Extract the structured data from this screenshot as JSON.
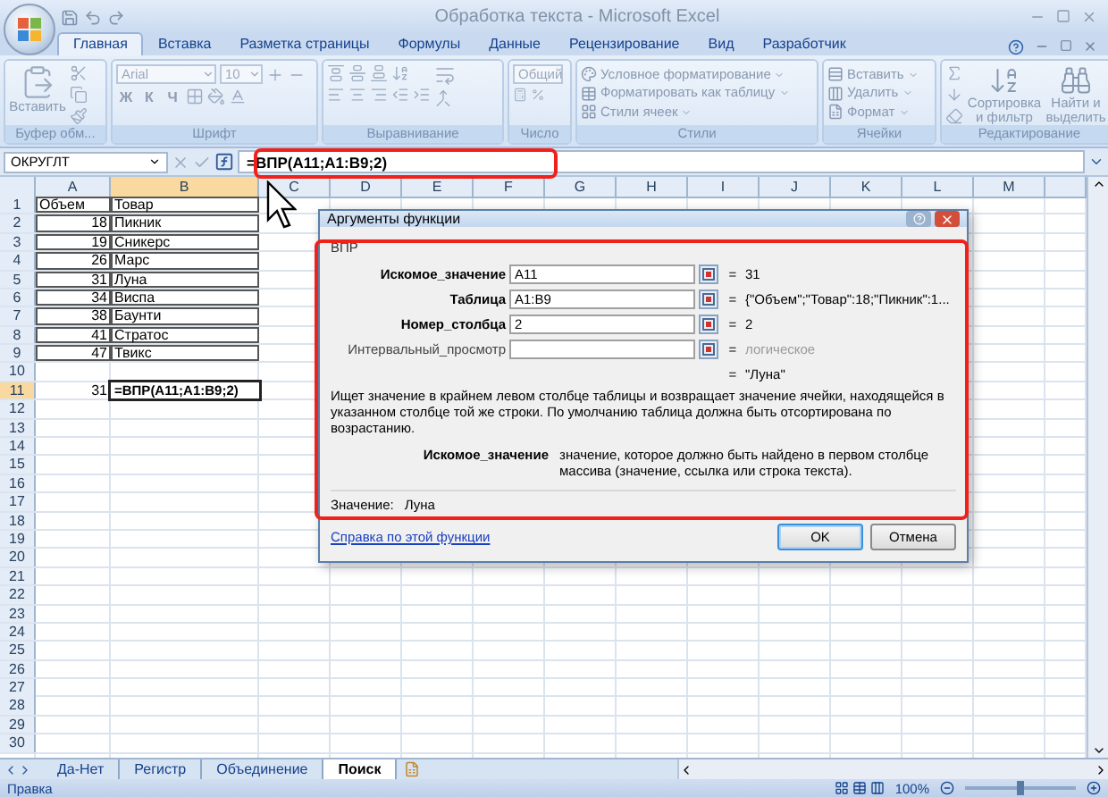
{
  "window": {
    "title": "Обработка текста - Microsoft Excel"
  },
  "ribbon_tabs": [
    {
      "label": "Главная",
      "selected": true
    },
    {
      "label": "Вставка",
      "selected": false
    },
    {
      "label": "Разметка страницы",
      "selected": false
    },
    {
      "label": "Формулы",
      "selected": false
    },
    {
      "label": "Данные",
      "selected": false
    },
    {
      "label": "Рецензирование",
      "selected": false
    },
    {
      "label": "Вид",
      "selected": false
    },
    {
      "label": "Разработчик",
      "selected": false
    }
  ],
  "ribbon": {
    "disabled": true,
    "groups": [
      {
        "label": "Буфер обм...",
        "kind": "clipboard",
        "buttons": [
          "Вставить"
        ]
      },
      {
        "label": "Шрифт",
        "kind": "font",
        "font": "Arial",
        "size": "10",
        "styles": [
          "Ж",
          "К",
          "Ч"
        ]
      },
      {
        "label": "Выравнивание",
        "kind": "alignment"
      },
      {
        "label": "Число",
        "kind": "number",
        "format": "Общий"
      },
      {
        "label": "Стили",
        "kind": "list",
        "buttons": [
          "Условное форматирование",
          "Форматировать как таблицу",
          "Стили ячеек"
        ]
      },
      {
        "label": "Ячейки",
        "kind": "list",
        "buttons": [
          "Вставить",
          "Удалить",
          "Формат"
        ]
      },
      {
        "label": "Редактирование",
        "kind": "editing",
        "buttons": [
          "Сортировка и фильтр",
          "Найти и выделить"
        ]
      }
    ]
  },
  "formula_bar": {
    "name_box": "ОКРУГЛТ",
    "formula": "=ВПР(A11;A1:B9;2)"
  },
  "grid": {
    "columns": [
      {
        "label": "A",
        "selected": false
      },
      {
        "label": "B",
        "selected": true
      },
      {
        "label": "C",
        "selected": false
      },
      {
        "label": "D",
        "selected": false
      },
      {
        "label": "E",
        "selected": false
      },
      {
        "label": "F",
        "selected": false
      },
      {
        "label": "G",
        "selected": false
      },
      {
        "label": "H",
        "selected": false
      },
      {
        "label": "I",
        "selected": false
      },
      {
        "label": "J",
        "selected": false
      },
      {
        "label": "K",
        "selected": false
      },
      {
        "label": "L",
        "selected": false
      },
      {
        "label": "M",
        "selected": false
      }
    ],
    "rows": [
      {
        "number": "1",
        "selected": false,
        "bordered": true,
        "cells": [
          {
            "text": "Объем",
            "kind": "text"
          },
          {
            "text": "Товар",
            "kind": "text"
          }
        ]
      },
      {
        "number": "2",
        "selected": false,
        "bordered": true,
        "cells": [
          {
            "text": "18",
            "kind": "number"
          },
          {
            "text": "Пикник",
            "kind": "text"
          }
        ]
      },
      {
        "number": "3",
        "selected": false,
        "bordered": true,
        "cells": [
          {
            "text": "19",
            "kind": "number"
          },
          {
            "text": "Сникерс",
            "kind": "text"
          }
        ]
      },
      {
        "number": "4",
        "selected": false,
        "bordered": true,
        "cells": [
          {
            "text": "26",
            "kind": "number"
          },
          {
            "text": "Марс",
            "kind": "text"
          }
        ]
      },
      {
        "number": "5",
        "selected": false,
        "bordered": true,
        "cells": [
          {
            "text": "31",
            "kind": "number"
          },
          {
            "text": "Луна",
            "kind": "text"
          }
        ]
      },
      {
        "number": "6",
        "selected": false,
        "bordered": true,
        "cells": [
          {
            "text": "34",
            "kind": "number"
          },
          {
            "text": "Виспа",
            "kind": "text"
          }
        ]
      },
      {
        "number": "7",
        "selected": false,
        "bordered": true,
        "cells": [
          {
            "text": "38",
            "kind": "number"
          },
          {
            "text": "Баунти",
            "kind": "text"
          }
        ]
      },
      {
        "number": "8",
        "selected": false,
        "bordered": true,
        "cells": [
          {
            "text": "41",
            "kind": "number"
          },
          {
            "text": "Стратос",
            "kind": "text"
          }
        ]
      },
      {
        "number": "9",
        "selected": false,
        "bordered": true,
        "cells": [
          {
            "text": "47",
            "kind": "number"
          },
          {
            "text": "Твикс",
            "kind": "text"
          }
        ]
      },
      {
        "number": "10",
        "selected": false
      },
      {
        "number": "11",
        "selected": true,
        "bordered": false,
        "cells": [
          {
            "text": "31",
            "kind": "number"
          },
          {
            "text": "=ВПР(A11;A1:B9;2)",
            "kind": "formula"
          }
        ]
      },
      {
        "number": "12",
        "selected": false
      },
      {
        "number": "13",
        "selected": false
      },
      {
        "number": "14",
        "selected": false
      },
      {
        "number": "15",
        "selected": false
      },
      {
        "number": "16",
        "selected": false
      },
      {
        "number": "17",
        "selected": false
      },
      {
        "number": "18",
        "selected": false
      },
      {
        "number": "19",
        "selected": false
      },
      {
        "number": "20",
        "selected": false
      },
      {
        "number": "21",
        "selected": false
      },
      {
        "number": "22",
        "selected": false
      },
      {
        "number": "23",
        "selected": false
      },
      {
        "number": "24",
        "selected": false
      },
      {
        "number": "25",
        "selected": false
      },
      {
        "number": "26",
        "selected": false
      },
      {
        "number": "27",
        "selected": false
      },
      {
        "number": "28",
        "selected": false
      },
      {
        "number": "29",
        "selected": false
      },
      {
        "number": "30",
        "selected": false
      }
    ]
  },
  "dialog": {
    "title": "Аргументы функции",
    "function": "ВПР",
    "arguments": [
      {
        "name": "Искомое_значение",
        "value": "A11",
        "equals": "=",
        "result": "31",
        "required": true
      },
      {
        "name": "Таблица",
        "value": "A1:B9",
        "equals": "=",
        "result": "{\"Объем\";\"Товар\":18;\"Пикник\":1...",
        "required": true
      },
      {
        "name": "Номер_столбца",
        "value": "2",
        "equals": "=",
        "result": "2",
        "required": true
      },
      {
        "name": "Интервальный_просмотр",
        "equals": "=",
        "result": "логическое",
        "required": false
      }
    ],
    "formula_result": {
      "equals": "=",
      "value": "\"Луна\""
    },
    "description": "Ищет значение в крайнем левом столбце таблицы и возвращает значение ячейки, находящейся в указанном столбце той же строки. По умолчанию таблица должна быть отсортирована по возрастанию.",
    "argument_help": {
      "name": "Искомое_значение",
      "text": "значение, которое должно быть найдено в первом столбце массива (значение, ссылка или строка текста)."
    },
    "value_line": {
      "label": "Значение:",
      "value": "Луна"
    },
    "help_link": "Справка по этой функции",
    "buttons": [
      {
        "label": "OK",
        "default": true
      },
      {
        "label": "Отмена",
        "default": false
      }
    ]
  },
  "sheet_tabs": [
    {
      "label": "Да-Нет",
      "selected": false
    },
    {
      "label": "Регистр",
      "selected": false
    },
    {
      "label": "Объединение",
      "selected": false
    },
    {
      "label": "Поиск",
      "selected": true
    }
  ],
  "status_bar": {
    "mode": "Правка",
    "zoom": "100%",
    "zoom_slider": {
      "level": 0.5
    }
  }
}
